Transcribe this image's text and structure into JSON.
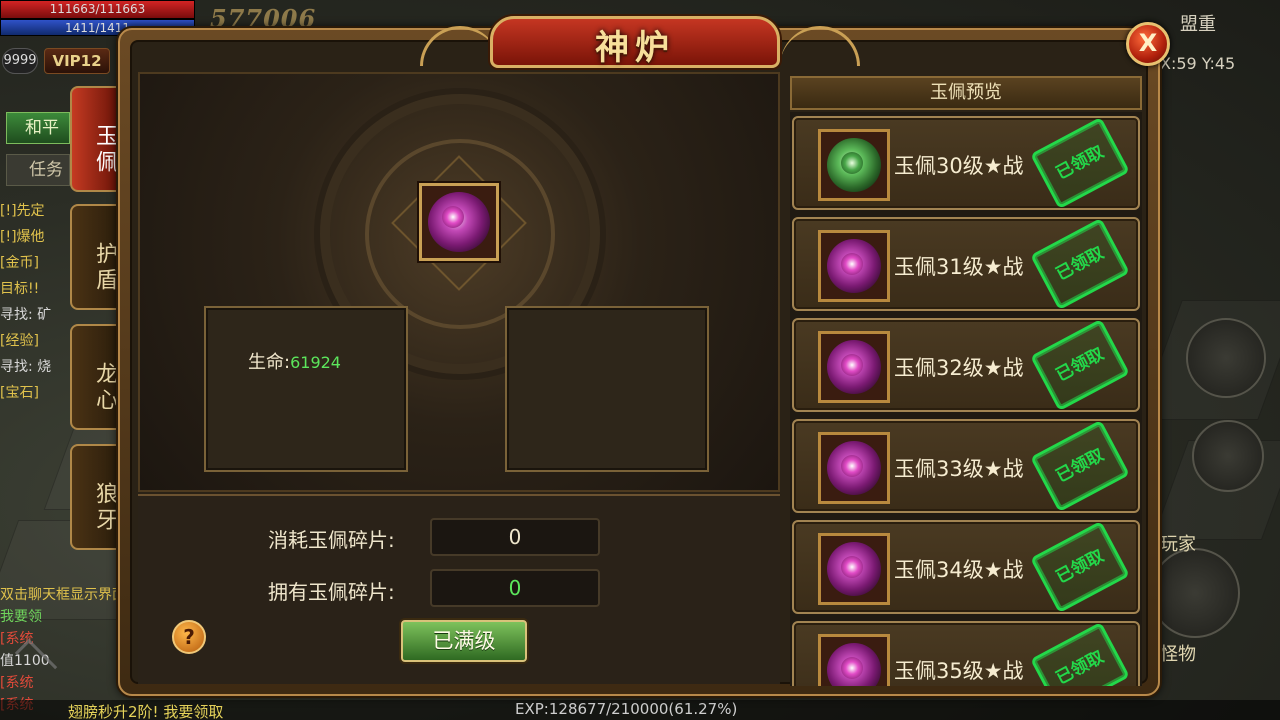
{
  "hud": {
    "hp_text": "111663/111663",
    "mp_text": "1411/1411",
    "combat_power": "577006",
    "level": "9999",
    "vip": "VIP12",
    "mode": "和平",
    "task": "任务",
    "guild_name": "盟重",
    "coords": "X:59  Y:45",
    "right_labels": [
      "玩家",
      "怪物"
    ],
    "exp_text": "EXP:128677/210000(61.27%)",
    "bottom_message": "翅膀秒升2阶! 我要领取"
  },
  "chat_lines": [
    {
      "text": "[!]先定",
      "color": "c-y"
    },
    {
      "text": "[!]爆他",
      "color": "c-y"
    },
    {
      "text": "[金币]",
      "color": "c-y"
    },
    {
      "text": "目标!!",
      "color": "c-y"
    },
    {
      "text": "寻找: 矿",
      "color": "c-w"
    },
    {
      "text": "[经验]",
      "color": "c-y"
    },
    {
      "text": "寻找: 烧",
      "color": "c-w"
    },
    {
      "text": "[宝石]",
      "color": "c-y"
    }
  ],
  "chat_bottom": [
    {
      "text": "双击聊天框显示界面",
      "color": "c-y"
    },
    {
      "text": "我要领",
      "color": "c-g"
    },
    {
      "text": "[系统",
      "color": "c-r"
    },
    {
      "text": "值1100",
      "color": "c-w"
    },
    {
      "text": "[系统",
      "color": "c-r"
    },
    {
      "text": "[系统",
      "color": "c-r"
    }
  ],
  "dialog": {
    "title": "神炉",
    "close_label": "X",
    "tabs": [
      "玉佩",
      "护盾",
      "龙心",
      "狼牙"
    ],
    "active_tab": 0,
    "stat": {
      "label": "生命:",
      "value": "61924"
    },
    "consume_label": "消耗玉佩碎片:",
    "consume_value": "0",
    "own_label": "拥有玉佩碎片:",
    "own_value": "0",
    "help_label": "?",
    "maxed_label": "已满级",
    "preview_title": "玉佩预览",
    "preview_items": [
      {
        "name": "玉佩30级★战",
        "stamp": "已领取",
        "icon": "green-jade"
      },
      {
        "name": "玉佩31级★战",
        "stamp": "已领取",
        "icon": "purple-jade"
      },
      {
        "name": "玉佩32级★战",
        "stamp": "已领取",
        "icon": "purple-jade"
      },
      {
        "name": "玉佩33级★战",
        "stamp": "已领取",
        "icon": "purple-jade"
      },
      {
        "name": "玉佩34级★战",
        "stamp": "已领取",
        "icon": "purple-jade"
      },
      {
        "name": "玉佩35级★战",
        "stamp": "已领取",
        "icon": "purple-jade"
      }
    ]
  }
}
